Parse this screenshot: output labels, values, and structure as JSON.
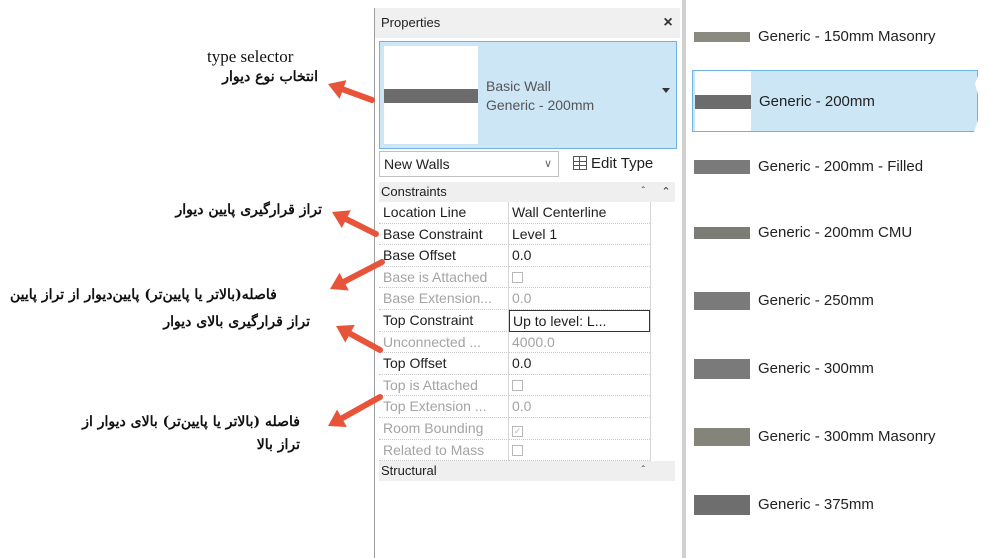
{
  "annotations": {
    "type_selector_en": "type selector",
    "type_selector_fa": "انتخاب نوع دیوار",
    "base_constraint_fa": "تراز قرارگیری پایین دیوار",
    "base_offset_fa": "فاصله(بالاتر یا پایین‌تر) پایین‌دیوار از تراز پایین",
    "top_constraint_fa": "تراز قرارگیری بالای دیوار",
    "top_offset_fa_line1": "فاصله (بالاتر یا پایین‌تر) بالای دیوار از",
    "top_offset_fa_line2": "تراز بالا",
    "arrow_color": "#e8543a"
  },
  "properties": {
    "title": "Properties",
    "close_glyph": "×",
    "type_selector": {
      "family": "Basic Wall",
      "type": "Generic - 200mm"
    },
    "instance_filter": "New Walls",
    "edit_type_label": "Edit Type",
    "groups": {
      "constraints": "Constraints",
      "structural": "Structural"
    },
    "rows": [
      {
        "name": "Location Line",
        "value": "Wall Centerline",
        "enabled": true
      },
      {
        "name": "Base Constraint",
        "value": "Level 1",
        "enabled": true
      },
      {
        "name": "Base Offset",
        "value": "0.0",
        "enabled": true
      },
      {
        "name": "Base is Attached",
        "value": "",
        "enabled": false,
        "checkbox": true,
        "checked": false
      },
      {
        "name": "Base Extension...",
        "value": "0.0",
        "enabled": false
      },
      {
        "name": "Top Constraint",
        "value": "Up to level: L...",
        "enabled": true,
        "active": true
      },
      {
        "name": "Unconnected ...",
        "value": "4000.0",
        "enabled": false
      },
      {
        "name": "Top Offset",
        "value": "0.0",
        "enabled": true
      },
      {
        "name": "Top is Attached",
        "value": "",
        "enabled": false,
        "checkbox": true,
        "checked": false
      },
      {
        "name": "Top Extension ...",
        "value": "0.0",
        "enabled": false
      },
      {
        "name": "Room Bounding",
        "value": "",
        "enabled": false,
        "checkbox": true,
        "checked": true
      },
      {
        "name": "Related to Mass",
        "value": "",
        "enabled": false,
        "checkbox": true,
        "checked": false
      }
    ],
    "structural_partial": "Str..."
  },
  "type_list": {
    "selected_index": 1,
    "items": [
      {
        "label": "Generic - 150mm Masonry",
        "swatch": "#8a8a80"
      },
      {
        "label": "Generic - 200mm",
        "swatch": "#6c6c6c"
      },
      {
        "label": "Generic - 200mm - Filled",
        "swatch": "#7a7a7a"
      },
      {
        "label": "Generic - 200mm CMU",
        "swatch": "#7c7c76"
      },
      {
        "label": "Generic - 250mm",
        "swatch": "#7a7a7a"
      },
      {
        "label": "Generic - 300mm",
        "swatch": "#7a7a7a"
      },
      {
        "label": "Generic - 300mm Masonry",
        "swatch": "#84847a"
      },
      {
        "label": "Generic - 375mm",
        "swatch": "#6e6e6e"
      }
    ]
  },
  "colors": {
    "selection_fill": "#cce6f6",
    "selection_border": "#6fb3e0",
    "panel_header": "#f0f0f0"
  }
}
